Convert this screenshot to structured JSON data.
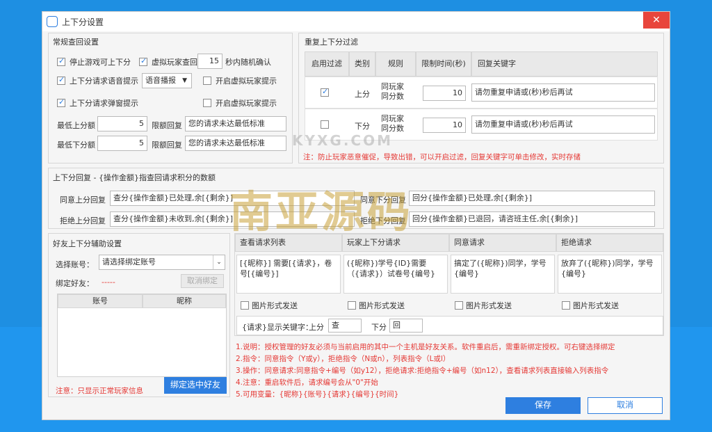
{
  "window": {
    "title": "上下分设置",
    "close": "✕"
  },
  "general": {
    "title": "常规查回设置",
    "stop_game": "停止游戏可上下分",
    "virtual_check": "虚拟玩家查回",
    "seconds": "15",
    "seconds_suffix": "秒内随机确认",
    "voice_prompt": "上下分请求语音提示",
    "voice_select": "语音播报",
    "enable_virtual_1": "开启虚拟玩家提示",
    "popup_prompt": "上下分请求弹窗提示",
    "enable_virtual_2": "开启虚拟玩家提示",
    "min_up_label": "最低上分额",
    "min_up_value": "5",
    "limit_reply_label_1": "限额回复",
    "limit_reply_1": "您的请求未达最低标准",
    "min_down_label": "最低下分额",
    "min_down_value": "5",
    "limit_reply_label_2": "限额回复",
    "limit_reply_2": "您的请求未达最低标准"
  },
  "filter": {
    "title": "重复上下分过滤",
    "headers": [
      "启用过滤",
      "类别",
      "规则",
      "限制时间(秒)",
      "回复关键字"
    ],
    "rows": [
      {
        "enabled": true,
        "type": "上分",
        "rule": "同玩家同分数",
        "time": "10",
        "reply": "请勿重复申请或(秒)秒后再试"
      },
      {
        "enabled": false,
        "type": "下分",
        "rule": "同玩家同分数",
        "time": "10",
        "reply": "请勿重复申请或(秒)秒后再试"
      }
    ],
    "note": "注：防止玩家恶意催促，导致出错，可以开启过滤，回复关键字可单击修改，实时存储"
  },
  "reply": {
    "title": "上下分回复 - {操作金额}指查回请求积分的数额",
    "agree_up_label": "同意上分回复",
    "agree_up": "查分{操作金额}已处理,余[{剩余}]",
    "agree_down_label": "同意下分回复",
    "agree_down": "回分{操作金额}已处理,余[{剩余}]",
    "reject_up_label": "拒绝上分回复",
    "reject_up": "查分{操作金额}未收到,余[{剩余}]",
    "reject_down_label": "拒绝下分回复",
    "reject_down": "回分{操作金额}已退回，请咨班主任,余[{剩余}]"
  },
  "friend": {
    "title": "好友上下分辅助设置",
    "select_label": "选择账号：",
    "select_value": "请选择绑定账号",
    "bound_label": "绑定好友：",
    "bound_value": "-----",
    "unbind": "取消绑定",
    "col_account": "账号",
    "col_nick": "昵称",
    "note": "注意：只显示正常玩家信息",
    "bind_button": "绑定选中好友"
  },
  "commands": {
    "headers": [
      "查看请求列表",
      "玩家上下分请求",
      "同意请求",
      "拒绝请求"
    ],
    "texts": [
      "[{昵称}] 需要[{请求}，卷号[{编号}]",
      "({昵称})学号{ID}需要（{请求}）试卷号{编号}",
      "搞定了({昵称})同学，学号{编号}",
      "放弃了({昵称})同学，学号{编号}"
    ],
    "image_send": "图片形式发送",
    "keyword_label": "{请求}显示关键字：",
    "up_label": "上分",
    "up_value": "查",
    "down_label": "下分",
    "down_value": "回"
  },
  "notes": [
    "1.说明：授权管理的好友必须与当前启用的其中一个主机是好友关系。软件重启后，需重新绑定授权。可右键选择绑定",
    "2.指令：同意指令（Y或y），拒绝指令（N或n），列表指令（L或l）",
    "3.操作：同意请求:同意指令+编号（如y12），拒绝请求:拒绝指令+编号（如n12），查看请求列表直接输入列表指令",
    "4.注意：重启软件后，请求编号会从\"0\"开始",
    "5.可用变量：{昵称}{账号}{请求}{编号}{时间}"
  ],
  "buttons": {
    "save": "保存",
    "cancel": "取消"
  },
  "watermark": {
    "top": "KYXG.COM",
    "main": "南亚源码"
  }
}
